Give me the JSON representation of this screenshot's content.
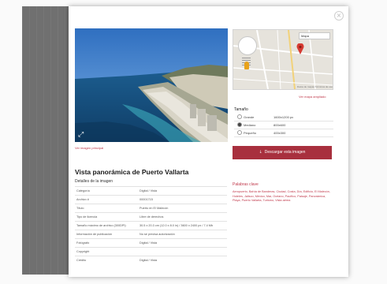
{
  "colors": {
    "accent": "#c0394b",
    "button_bg": "#a8303e",
    "overlay": "#707070"
  },
  "modal": {
    "close_icon": "×",
    "image_link": "Ver imagen principal",
    "map_type_label": "Mapa",
    "map_footer": "Datos de mapas  Términos de uso",
    "map_link": "Ver mapa ampliado",
    "size": {
      "title": "Tamaño",
      "options": [
        {
          "label": "Grande",
          "value": "1600x1200 px",
          "selected": false
        },
        {
          "label": "Mediano",
          "value": "800x600",
          "selected": true
        },
        {
          "label": "Pequeño",
          "value": "400x300",
          "selected": false
        }
      ]
    },
    "download_button": "Descargar esta imagen",
    "download_icon": "↓",
    "title": "Vista panorámica de Puerto Vallarta",
    "details_heading": "Detalles de la imagen",
    "details": [
      {
        "label": "Categoría",
        "value": "Digital / Vista"
      },
      {
        "label": "Archivo #",
        "value": "00001715"
      },
      {
        "label": "Título",
        "value": "Puerto en El Malecón"
      },
      {
        "label": "Tipo de licencia",
        "value": "Libre de derechos"
      },
      {
        "label": "Tamaño máximo de archivo (300DPI)",
        "value": "30.5 x 20.3 cm (12.0 x 8.0 in) / 3600 x 2400 px / 7.4 Mb"
      },
      {
        "label": "Información de publicación",
        "value": "No se precisa autorización"
      },
      {
        "label": "Fotógrafo",
        "value": "Digital / Vista"
      },
      {
        "label": "Copyright",
        "value": ""
      },
      {
        "label": "Crédito",
        "value": "Digital / Vista"
      }
    ],
    "keywords_title": "Palabras clave",
    "keywords_text": "Aeropuerto, Bahía de Banderas, Ciudad, Costa, Día, Edificio, El Malecón, Hoteles, Jalisco, México, Mar, Océano, Pacífico, Paisaje, Panorámica, Playa, Puerto Vallarta, Turismo, Vista aérea"
  }
}
